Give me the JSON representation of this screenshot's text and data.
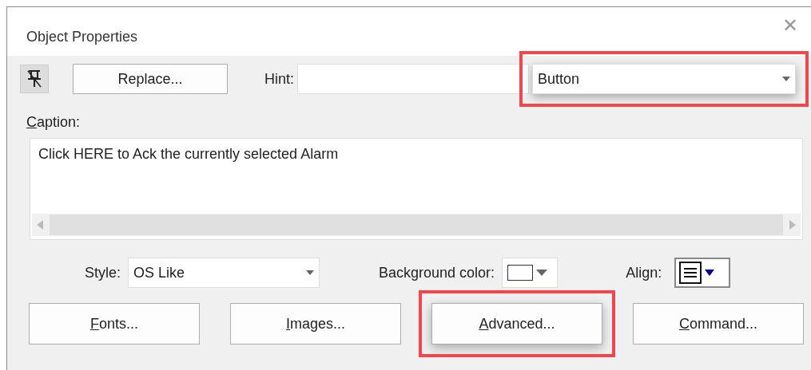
{
  "window": {
    "title": "Object Properties",
    "close": "✕"
  },
  "toolbar": {
    "pin_pressed": true,
    "replace_button": "Replace...",
    "hint_label": "Hint:",
    "type_dropdown": {
      "value": "Button",
      "highlight": true
    }
  },
  "caption": {
    "label": "Caption:",
    "underline_first": true,
    "text": "Click HERE to Ack the currently selected Alarm"
  },
  "style": {
    "label": "Style:",
    "value": "OS Like"
  },
  "background_color": {
    "label": "Background color:",
    "color": "#ffffff"
  },
  "align": {
    "label": "Align:"
  },
  "buttons": [
    {
      "label": "Fonts...",
      "underline_first": true,
      "highlight": false
    },
    {
      "label": "Images...",
      "underline_first": true,
      "highlight": false
    },
    {
      "label": "Advanced...",
      "underline_first": true,
      "highlight": true
    },
    {
      "label": "Command...",
      "underline_first": true,
      "highlight": false
    }
  ]
}
